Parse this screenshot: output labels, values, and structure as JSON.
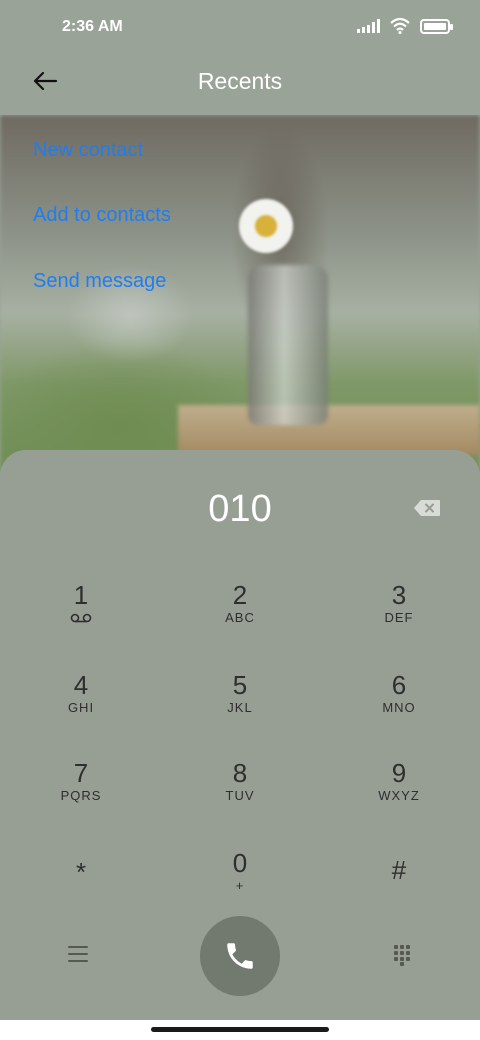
{
  "status_bar": {
    "time": "2:36 AM",
    "icons": [
      "signal-icon",
      "wifi-icon",
      "battery-icon"
    ]
  },
  "header": {
    "title": "Recents",
    "back_icon": "arrow-left-icon"
  },
  "actions": [
    {
      "label": "New contact"
    },
    {
      "label": "Add to contacts"
    },
    {
      "label": "Send message"
    }
  ],
  "dialer": {
    "number": "010",
    "keys": [
      {
        "digit": "1",
        "letters": ""
      },
      {
        "digit": "2",
        "letters": "ABC"
      },
      {
        "digit": "3",
        "letters": "DEF"
      },
      {
        "digit": "4",
        "letters": "GHI"
      },
      {
        "digit": "5",
        "letters": "JKL"
      },
      {
        "digit": "6",
        "letters": "MNO"
      },
      {
        "digit": "7",
        "letters": "PQRS"
      },
      {
        "digit": "8",
        "letters": "TUV"
      },
      {
        "digit": "9",
        "letters": "WXYZ"
      },
      {
        "digit": "*",
        "letters": ""
      },
      {
        "digit": "0",
        "letters": "+"
      },
      {
        "digit": "#",
        "letters": ""
      }
    ]
  },
  "colors": {
    "accent_link": "#1e7ef0",
    "sheet": "#979f94",
    "call_button": "#727a6f"
  }
}
